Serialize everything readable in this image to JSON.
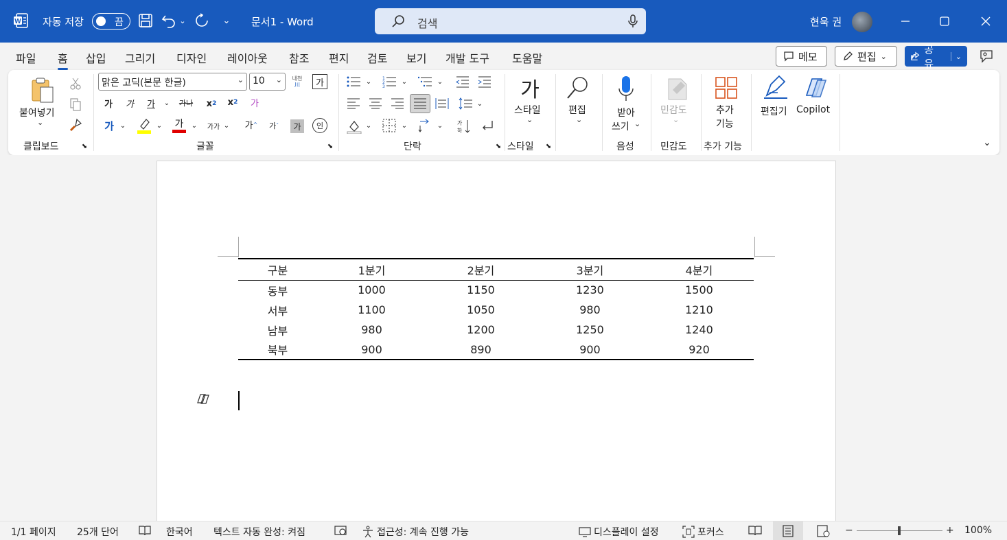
{
  "titlebar": {
    "autosave_label": "자동 저장",
    "autosave_state": "끔",
    "doc_title": "문서1  -  Word",
    "search_placeholder": "검색",
    "user_name": "현욱 권"
  },
  "menu": {
    "tabs": [
      "파일",
      "홈",
      "삽입",
      "그리기",
      "디자인",
      "레이아웃",
      "참조",
      "편지",
      "검토",
      "보기",
      "개발 도구",
      "도움말"
    ],
    "active_tab": "홈",
    "memo_label": "메모",
    "edit_label": "편집",
    "share_label": "공유"
  },
  "ribbon": {
    "clipboard": {
      "paste_label": "붙여넣기",
      "group_label": "클립보드"
    },
    "font": {
      "font_name": "맑은 고딕(본문 한글)",
      "font_size": "10",
      "phonetic_top": "내천",
      "phonetic_bottom": "川",
      "char_border": "가",
      "bold": "가",
      "italic": "가",
      "underline": "가",
      "strike": "가나",
      "sub": "x",
      "sub_small": "2",
      "sup": "x",
      "sup_small": "2",
      "clear": "가",
      "text_effect": "가",
      "highlight_color": "#ffff00",
      "font_color_glyph": "가",
      "font_color": "#e00000",
      "change_case": "가가",
      "grow": "가",
      "shrink": "가",
      "shading": "가",
      "enclose": "인",
      "group_label": "글꼴"
    },
    "paragraph": {
      "group_label": "단락"
    },
    "styles": {
      "glyph": "가",
      "label": "스타일",
      "group_label": "스타일"
    },
    "editing": {
      "label": "편집"
    },
    "voice": {
      "label_1": "받아",
      "label_2": "쓰기",
      "group_label": "음성"
    },
    "sensitivity": {
      "label": "민감도",
      "group_label": "민감도"
    },
    "addins": {
      "label_1": "추가",
      "label_2": "기능",
      "group_label": "추가 기능"
    },
    "editor": {
      "label": "편집기"
    },
    "copilot": {
      "label": "Copilot"
    }
  },
  "document": {
    "table": {
      "headers": [
        "구분",
        "1분기",
        "2분기",
        "3분기",
        "4분기"
      ],
      "rows": [
        [
          "동부",
          "1000",
          "1150",
          "1230",
          "1500"
        ],
        [
          "서부",
          "1100",
          "1050",
          "980",
          "1210"
        ],
        [
          "남부",
          "980",
          "1200",
          "1250",
          "1240"
        ],
        [
          "북부",
          "900",
          "890",
          "900",
          "920"
        ]
      ]
    }
  },
  "statusbar": {
    "page": "1/1 페이지",
    "words": "25개 단어",
    "language": "한국어",
    "autocomplete": "텍스트 자동 완성: 켜짐",
    "accessibility": "접근성: 계속 진행 가능",
    "display": "디스플레이 설정",
    "focus": "포커스",
    "zoom": "100%",
    "zoom_minus": "−",
    "zoom_plus": "+"
  }
}
